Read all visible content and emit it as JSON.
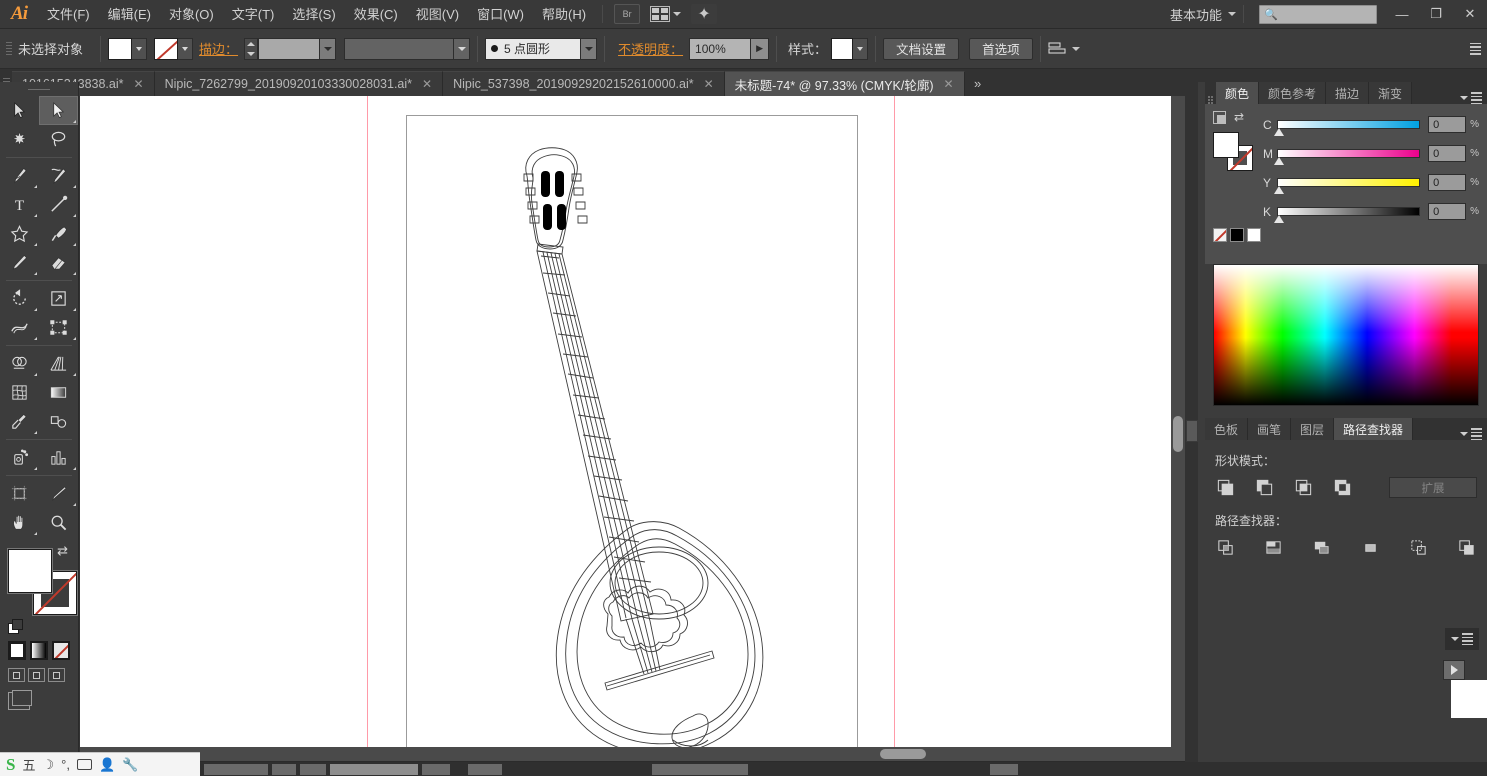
{
  "app": {
    "logo": "Ai",
    "title": "Adobe Illustrator"
  },
  "menubar": {
    "items": [
      {
        "label": "文件(F)",
        "name": "menu-file"
      },
      {
        "label": "编辑(E)",
        "name": "menu-edit"
      },
      {
        "label": "对象(O)",
        "name": "menu-object"
      },
      {
        "label": "文字(T)",
        "name": "menu-type"
      },
      {
        "label": "选择(S)",
        "name": "menu-select"
      },
      {
        "label": "效果(C)",
        "name": "menu-effect"
      },
      {
        "label": "视图(V)",
        "name": "menu-view"
      },
      {
        "label": "窗口(W)",
        "name": "menu-window"
      },
      {
        "label": "帮助(H)",
        "name": "menu-help"
      }
    ],
    "bridge_icon": "Br",
    "arrange_icon": "arrange-documents-icon",
    "stock_icon": "adobe-stock-icon",
    "workspace": "基本功能",
    "search_placeholder": "",
    "minimize": "—",
    "restore": "❐",
    "close": "✕"
  },
  "controlbar": {
    "selection_label": "未选择对象",
    "fill_swatch": "#ffffff",
    "stroke_swatch": "none",
    "stroke_link_label": "描边：",
    "stroke_weight_value": "",
    "stroke_profile_value": "",
    "brush_value": "5 点圆形",
    "opacity_label": "不透明度：",
    "opacity_value": "100%",
    "style_label": "样式：",
    "style_swatch": "#ffffff",
    "document_setup_button": "文档设置",
    "preferences_button": "首选项",
    "align_icon": "align-objects-icon"
  },
  "tabs": {
    "items": [
      {
        "label": "101615243838.ai*",
        "active": false,
        "name": "doc-tab-1"
      },
      {
        "label": "Nipic_7262799_20190920103330028031.ai*",
        "active": false,
        "name": "doc-tab-2"
      },
      {
        "label": "Nipic_537398_20190929202152610000.ai*",
        "active": false,
        "name": "doc-tab-3"
      },
      {
        "label": "未标题-74* @ 97.33% (CMYK/轮廓)",
        "active": true,
        "name": "doc-tab-4"
      }
    ],
    "overflow": "»"
  },
  "toolbar": {
    "tools": [
      {
        "name": "selection-tool",
        "icon": "arrow-cursor",
        "selected": false
      },
      {
        "name": "direct-selection-tool",
        "icon": "white-arrow-cursor",
        "selected": true
      },
      {
        "name": "magic-wand-tool",
        "icon": "magic-wand",
        "selected": false
      },
      {
        "name": "lasso-tool",
        "icon": "lasso",
        "selected": false
      },
      {
        "name": "pen-tool",
        "icon": "pen-nib",
        "selected": false
      },
      {
        "name": "curvature-tool",
        "icon": "curvature",
        "selected": false
      },
      {
        "name": "type-tool",
        "icon": "text-T",
        "selected": false
      },
      {
        "name": "line-segment-tool",
        "icon": "diagonal-line",
        "selected": false
      },
      {
        "name": "shape-tool",
        "icon": "star-polygon",
        "selected": false
      },
      {
        "name": "paintbrush-tool",
        "icon": "paintbrush",
        "selected": false
      },
      {
        "name": "pencil-tool",
        "icon": "pencil",
        "selected": false
      },
      {
        "name": "eraser-tool",
        "icon": "eraser",
        "selected": false
      },
      {
        "name": "rotate-tool",
        "icon": "rotate-arrow",
        "selected": false
      },
      {
        "name": "scale-tool",
        "icon": "scale-box",
        "selected": false
      },
      {
        "name": "width-tool",
        "icon": "width-warp",
        "selected": false
      },
      {
        "name": "free-transform-tool",
        "icon": "free-transform",
        "selected": false
      },
      {
        "name": "shape-builder-tool",
        "icon": "shape-builder",
        "selected": false
      },
      {
        "name": "perspective-grid-tool",
        "icon": "perspective-grid",
        "selected": false
      },
      {
        "name": "mesh-tool",
        "icon": "mesh-grid",
        "selected": false
      },
      {
        "name": "gradient-tool",
        "icon": "gradient-bar",
        "selected": false
      },
      {
        "name": "eyedropper-tool",
        "icon": "eyedropper",
        "selected": false
      },
      {
        "name": "blend-tool",
        "icon": "blend-shapes",
        "selected": false
      },
      {
        "name": "symbol-sprayer-tool",
        "icon": "symbol-sprayer",
        "selected": false
      },
      {
        "name": "column-graph-tool",
        "icon": "bar-chart",
        "selected": false
      },
      {
        "name": "artboard-tool",
        "icon": "artboard-frame",
        "selected": false
      },
      {
        "name": "slice-tool",
        "icon": "slice-knife",
        "selected": false
      },
      {
        "name": "hand-tool",
        "icon": "hand",
        "selected": false
      },
      {
        "name": "zoom-tool",
        "icon": "magnifier",
        "selected": false
      }
    ],
    "fill_color": "#ffffff",
    "stroke_color": "none",
    "swap_icon": "swap-fill-stroke-icon",
    "default_icon": "default-fill-stroke-icon",
    "color_mode_color": "color-mode-icon",
    "color_mode_gradient": "gradient-mode-icon",
    "color_mode_none": "none-mode-icon",
    "draw_modes": [
      "draw-normal-icon",
      "draw-behind-icon",
      "draw-inside-icon"
    ],
    "screen_mode": "screen-mode-icon"
  },
  "canvas": {
    "artwork_name": "lute-mandolin-line-art",
    "artboard_label": "",
    "zoom": "97.33%",
    "color_mode": "CMYK/轮廓"
  },
  "color_panel": {
    "tabs": [
      {
        "label": "颜色",
        "active": true,
        "name": "panel-tab-color"
      },
      {
        "label": "颜色参考",
        "active": false,
        "name": "panel-tab-color-guide"
      },
      {
        "label": "描边",
        "active": false,
        "name": "panel-tab-stroke"
      },
      {
        "label": "渐变",
        "active": false,
        "name": "panel-tab-gradient"
      }
    ],
    "sliders": [
      {
        "label": "C",
        "value": "0",
        "unit": "%",
        "color": "#00a0e0"
      },
      {
        "label": "M",
        "value": "0",
        "unit": "%",
        "color": "#ec008c"
      },
      {
        "label": "Y",
        "value": "0",
        "unit": "%",
        "color": "#fff200"
      },
      {
        "label": "K",
        "value": "0",
        "unit": "%",
        "color": "#000000"
      }
    ],
    "quick_swatches": [
      "none",
      "#000000",
      "#ffffff"
    ],
    "fill_color": "#ffffff",
    "stroke_color": "none",
    "menu_icon": "panel-menu-icon"
  },
  "pathfinder_panel": {
    "tabs": [
      {
        "label": "色板",
        "active": false,
        "name": "panel-tab-swatches"
      },
      {
        "label": "画笔",
        "active": false,
        "name": "panel-tab-brushes"
      },
      {
        "label": "图层",
        "active": false,
        "name": "panel-tab-layers"
      },
      {
        "label": "路径查找器",
        "active": true,
        "name": "panel-tab-pathfinder"
      }
    ],
    "shape_modes_label": "形状模式：",
    "shape_modes": [
      {
        "name": "unite-button",
        "icon": "unite-icon"
      },
      {
        "name": "minus-front-button",
        "icon": "minus-front-icon"
      },
      {
        "name": "intersect-button",
        "icon": "intersect-icon"
      },
      {
        "name": "exclude-button",
        "icon": "exclude-icon"
      }
    ],
    "expand_button": "扩展",
    "pathfinders_label": "路径查找器：",
    "pathfinders": [
      {
        "name": "divide-button",
        "icon": "divide-icon"
      },
      {
        "name": "trim-button",
        "icon": "trim-icon"
      },
      {
        "name": "merge-button",
        "icon": "merge-icon"
      },
      {
        "name": "crop-button",
        "icon": "crop-icon"
      },
      {
        "name": "outline-button",
        "icon": "outline-icon"
      },
      {
        "name": "minus-back-button",
        "icon": "minus-back-icon"
      }
    ]
  },
  "ime": {
    "logo": "S",
    "items": [
      "五",
      "☽",
      "°,",
      "keyboard-icon",
      "user-icon",
      "wrench-icon"
    ]
  }
}
